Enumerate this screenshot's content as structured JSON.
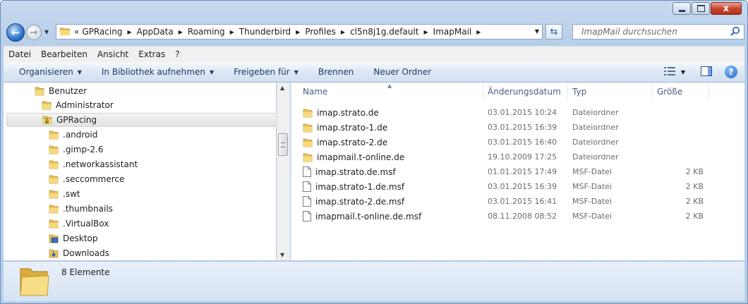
{
  "window": {
    "minimize_label": "",
    "maximize_label": "",
    "close_label": "x"
  },
  "address": {
    "overflow": "«",
    "crumbs": [
      "GPRacing",
      "AppData",
      "Roaming",
      "Thunderbird",
      "Profiles",
      "cl5n8j1g.default",
      "ImapMail"
    ]
  },
  "search": {
    "placeholder": "ImapMail durchsuchen"
  },
  "menu": [
    "Datei",
    "Bearbeiten",
    "Ansicht",
    "Extras",
    "?"
  ],
  "toolbar": {
    "organize": "Organisieren",
    "library": "In Bibliothek aufnehmen",
    "share": "Freigeben für",
    "burn": "Brennen",
    "new_folder": "Neuer Ordner"
  },
  "tree": [
    {
      "label": "Benutzer",
      "icon": "folder-icon"
    },
    {
      "label": "Administrator",
      "icon": "folder-icon"
    },
    {
      "label": "GPRacing",
      "icon": "locked-folder-icon",
      "selected": true
    },
    {
      "label": ".android",
      "icon": "folder-icon"
    },
    {
      "label": ".gimp-2.6",
      "icon": "folder-icon"
    },
    {
      "label": ".networkassistant",
      "icon": "folder-icon"
    },
    {
      "label": ".seccommerce",
      "icon": "folder-icon"
    },
    {
      "label": ".swt",
      "icon": "folder-icon"
    },
    {
      "label": ".thumbnails",
      "icon": "folder-icon"
    },
    {
      "label": ".VirtualBox",
      "icon": "folder-icon"
    },
    {
      "label": "Desktop",
      "icon": "desktop-icon"
    },
    {
      "label": "Downloads",
      "icon": "downloads-icon"
    }
  ],
  "columns": {
    "name": "Name",
    "date": "Änderungsdatum",
    "type": "Typ",
    "size": "Größe"
  },
  "files": [
    {
      "name": "imap.strato.de",
      "date": "03.01.2015 10:24",
      "type": "Dateiordner",
      "size": "",
      "icon": "folder-icon"
    },
    {
      "name": "imap.strato-1.de",
      "date": "03.01.2015 16:39",
      "type": "Dateiordner",
      "size": "",
      "icon": "folder-icon"
    },
    {
      "name": "imap.strato-2.de",
      "date": "03.01.2015 16:40",
      "type": "Dateiordner",
      "size": "",
      "icon": "folder-icon"
    },
    {
      "name": "imapmail.t-online.de",
      "date": "19.10.2009 17:25",
      "type": "Dateiordner",
      "size": "",
      "icon": "folder-icon"
    },
    {
      "name": "imap.strato.de.msf",
      "date": "01.01.2015 17:49",
      "type": "MSF-Datei",
      "size": "2 KB",
      "icon": "file-icon"
    },
    {
      "name": "imap.strato-1.de.msf",
      "date": "03.01.2015 16:39",
      "type": "MSF-Datei",
      "size": "2 KB",
      "icon": "file-icon"
    },
    {
      "name": "imap.strato-2.de.msf",
      "date": "03.01.2015 16:41",
      "type": "MSF-Datei",
      "size": "2 KB",
      "icon": "file-icon"
    },
    {
      "name": "imapmail.t-online.de.msf",
      "date": "08.11.2008 08:52",
      "type": "MSF-Datei",
      "size": "2 KB",
      "icon": "file-icon"
    }
  ],
  "status": {
    "count": "8 Elemente"
  }
}
